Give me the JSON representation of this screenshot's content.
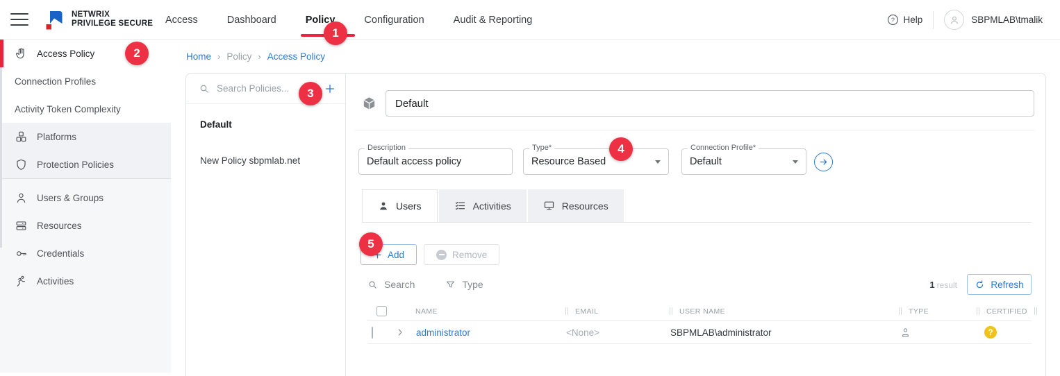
{
  "header": {
    "brand": {
      "line1": "NETWRIX",
      "line2": "PRIVILEGE SECURE"
    },
    "nav": {
      "items": [
        {
          "label": "Access"
        },
        {
          "label": "Dashboard"
        },
        {
          "label": "Policy",
          "active": true
        },
        {
          "label": "Configuration"
        },
        {
          "label": "Audit & Reporting"
        }
      ]
    },
    "help_label": "Help",
    "user_name": "SBPMLAB\\tmalik"
  },
  "sidebar": {
    "groups": [
      {
        "items": [
          {
            "label": "Access Policy",
            "icon": "hand-icon",
            "active": true
          },
          {
            "label": "Connection Profiles"
          },
          {
            "label": "Activity Token Complexity"
          }
        ]
      },
      {
        "items": [
          {
            "label": "Platforms",
            "icon": "cubes-icon"
          },
          {
            "label": "Protection Policies",
            "icon": "shield-icon"
          }
        ]
      },
      {
        "items": [
          {
            "label": "Users & Groups",
            "icon": "person-icon"
          },
          {
            "label": "Resources",
            "icon": "server-icon"
          },
          {
            "label": "Credentials",
            "icon": "key-icon"
          },
          {
            "label": "Activities",
            "icon": "runner-icon"
          }
        ]
      }
    ]
  },
  "breadcrumb": {
    "separator": "›",
    "items": [
      {
        "label": "Home"
      },
      {
        "label": "Policy"
      },
      {
        "label": "Access Policy"
      }
    ]
  },
  "policy_list": {
    "search_placeholder": "Search Policies...",
    "items": [
      {
        "label": "Default",
        "selected": true
      },
      {
        "label": "New Policy sbpmlab.net"
      }
    ]
  },
  "detail": {
    "title_value": "Default",
    "fields": {
      "description": {
        "label": "Description",
        "value": "Default access policy"
      },
      "type": {
        "label": "Type*",
        "value": "Resource Based"
      },
      "connection_profile": {
        "label": "Connection Profile*",
        "value": "Default"
      }
    },
    "tabs": {
      "items": [
        {
          "label": "Users",
          "active": true
        },
        {
          "label": "Activities"
        },
        {
          "label": "Resources"
        }
      ]
    },
    "actions": {
      "add_label": "Add",
      "remove_label": "Remove"
    },
    "filter": {
      "search_label": "Search",
      "type_label": "Type"
    },
    "results": {
      "count": "1",
      "label": "result"
    },
    "refresh_label": "Refresh",
    "table": {
      "columns": [
        {
          "label": "NAME"
        },
        {
          "label": "EMAIL"
        },
        {
          "label": "USER NAME"
        },
        {
          "label": "TYPE"
        },
        {
          "label": "CERTIFIED"
        }
      ],
      "rows": [
        {
          "name": "administrator",
          "email": "<None>",
          "user_name": "SBPMLAB\\administrator",
          "type_icon": "person-icon",
          "certified_icon": "question-badge",
          "certified_symbol": "?"
        }
      ]
    }
  },
  "annotations": [
    {
      "n": "1"
    },
    {
      "n": "2"
    },
    {
      "n": "3"
    },
    {
      "n": "4"
    },
    {
      "n": "5"
    }
  ],
  "colors": {
    "brand_red": "#e8253a",
    "annotation_red": "#ee3044",
    "link_blue": "#2b7bd3",
    "certified_yellow": "#f2c21c",
    "sidebar_gray": "#f1f2f5",
    "tab_gray": "#eef0f3"
  }
}
